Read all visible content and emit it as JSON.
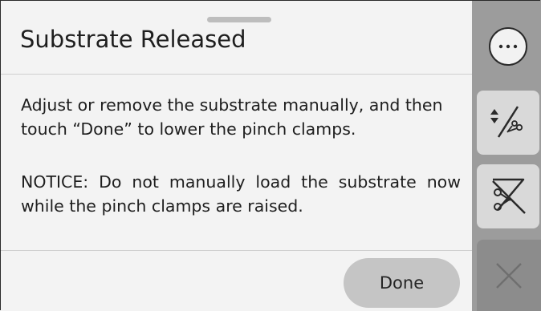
{
  "dialog": {
    "title": "Substrate Released",
    "paragraphs": [
      "Adjust or remove the substrate manually, and then touch “Done” to lower the pinch clamps.",
      "NOTICE: Do not manually load the substrate now while the pinch clamps are raised."
    ],
    "done_label": "Done"
  },
  "sidebar": {
    "buttons": [
      {
        "icon": "more-options-icon",
        "state": "enabled"
      },
      {
        "icon": "substrate-lift-cut-icon",
        "state": "enabled"
      },
      {
        "icon": "cut-disabled-icon",
        "state": "enabled"
      },
      {
        "icon": "close-icon",
        "state": "disabled"
      }
    ]
  },
  "colors": {
    "background": "#f3f3f3",
    "sidebar": "#9c9c9c",
    "tile": "#d9d9d9",
    "close_tile": "#8c8c8c",
    "done_button": "#c5c5c5"
  }
}
